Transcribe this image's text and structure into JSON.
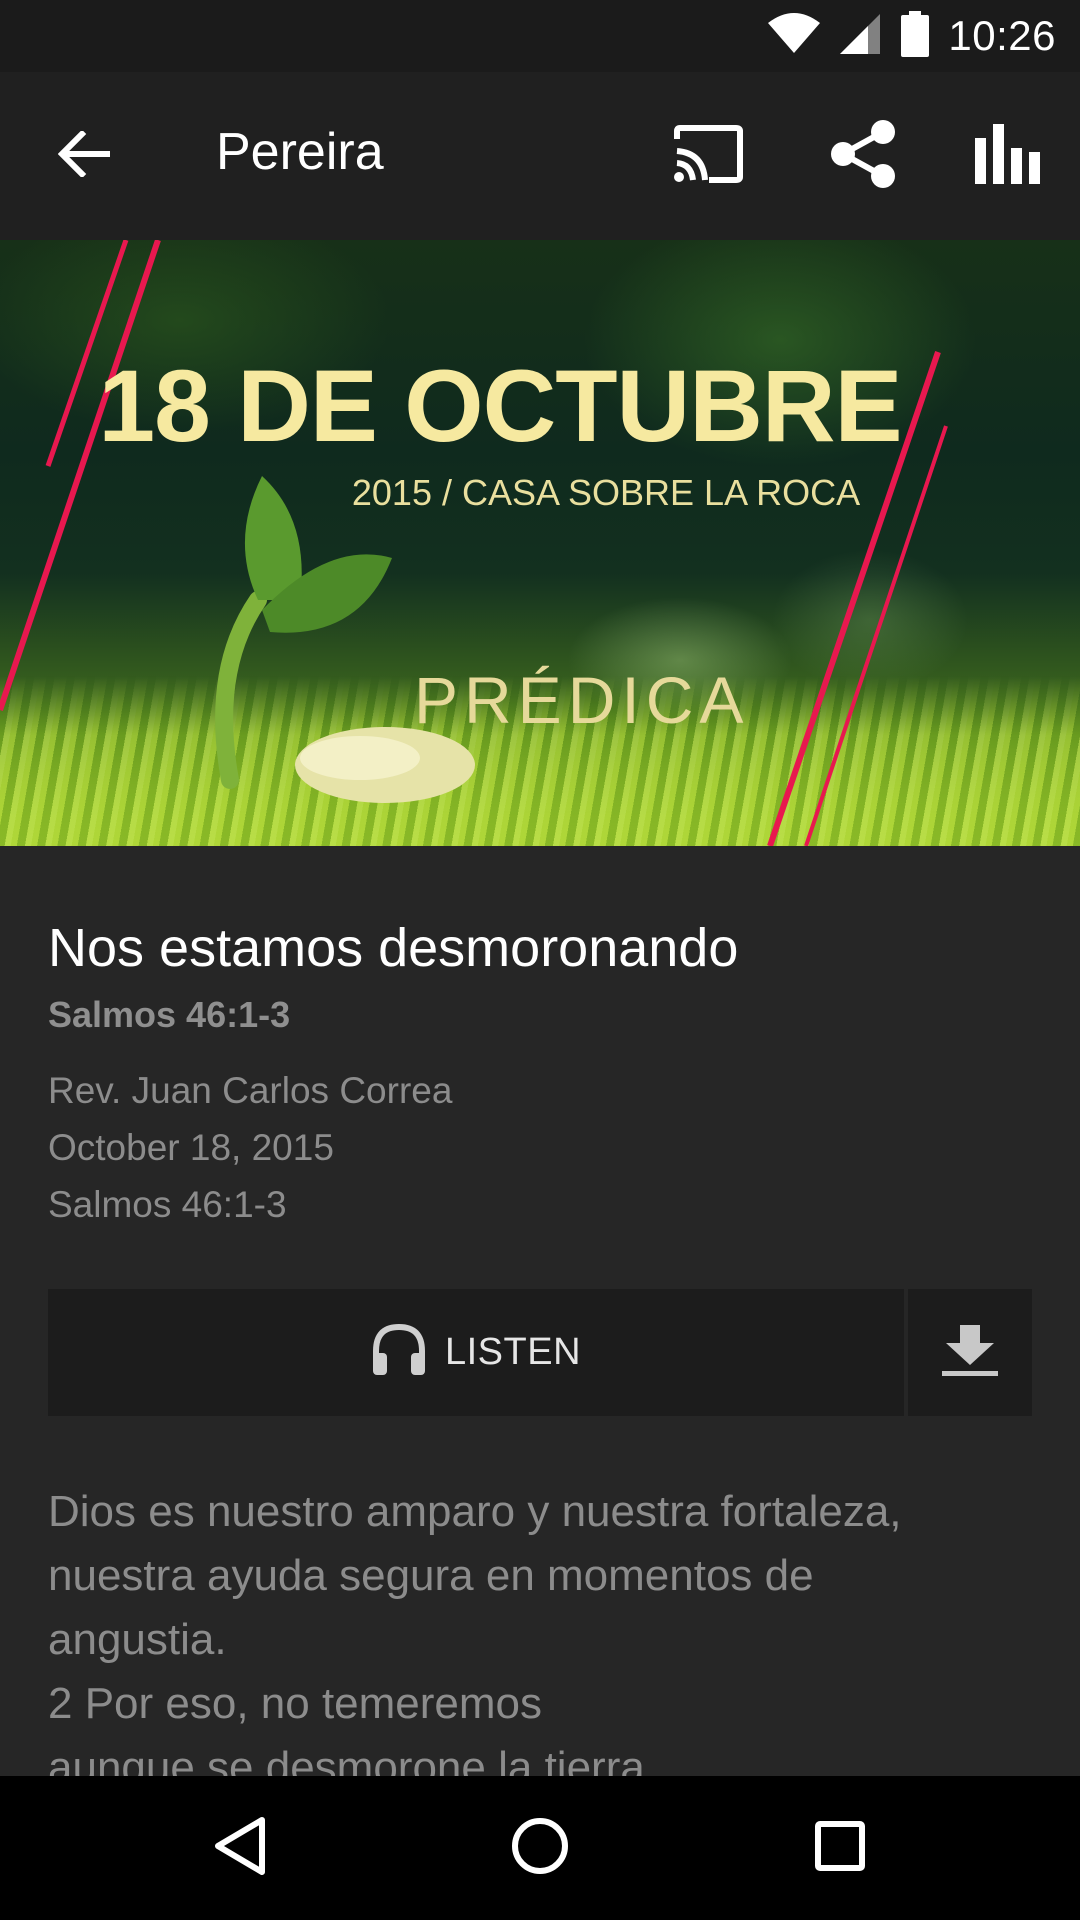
{
  "status_bar": {
    "time": "10:26",
    "icons": [
      "wifi-icon",
      "cell-signal-icon",
      "battery-icon"
    ]
  },
  "app_bar": {
    "title": "Pereira",
    "actions": [
      "arrow-back-icon",
      "cast-icon",
      "share-icon",
      "stats-icon"
    ]
  },
  "hero": {
    "title": "18 DE OCTUBRE",
    "subtitle": "2015 / CASA SOBRE LA ROCA",
    "tag": "PRÉDICA"
  },
  "sermon": {
    "title": "Nos estamos desmoronando",
    "reference": "Salmos 46:1-3",
    "speaker": "Rev. Juan Carlos Correa",
    "date": "October 18, 2015",
    "passage": "Salmos 46:1-3"
  },
  "actions": {
    "listen_label": "LISTEN",
    "listen_icon": "headphones-icon",
    "download_icon": "download-icon"
  },
  "description": {
    "lines": [
      "Dios es nuestro amparo y nuestra fortaleza,",
      "nuestra ayuda segura en momentos de",
      "angustia.",
      "2 Por eso, no temeremos",
      "aunque se desmorone la tierra,"
    ]
  },
  "nav_bar": {
    "buttons": [
      "nav-back-icon",
      "nav-home-icon",
      "nav-recents-icon"
    ]
  },
  "colors": {
    "background": "#262626",
    "app_bar": "#202020",
    "button_bg": "#1c1c1c",
    "muted_text": "#8c8c8c",
    "hero_accent": "#e8184f"
  }
}
